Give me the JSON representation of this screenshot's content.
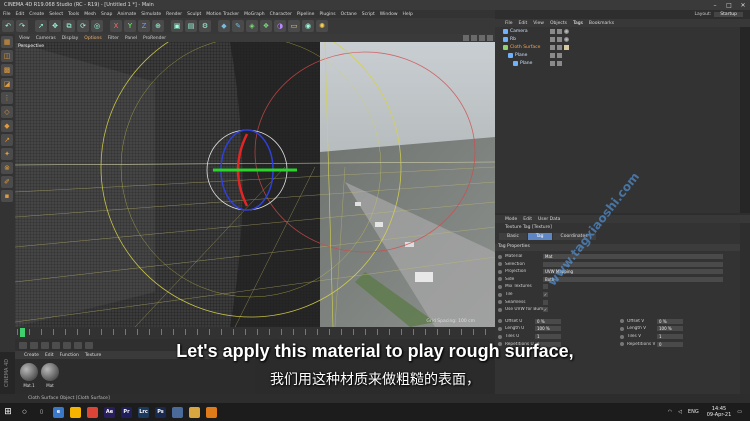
{
  "window": {
    "title": "CINEMA 4D R19.068 Studio (RC - R19) - [Untitled 1 *] - Main"
  },
  "menu": [
    "File",
    "Edit",
    "Create",
    "Select",
    "Tools",
    "Mesh",
    "Snap",
    "Animate",
    "Simulate",
    "Render",
    "Sculpt",
    "Motion Tracker",
    "MoGraph",
    "Character",
    "Pipeline",
    "Plugins",
    "Octane",
    "Script",
    "Window",
    "Help"
  ],
  "layout": {
    "label": "Layout:",
    "value": "Startup"
  },
  "viewport": {
    "menu": [
      "View",
      "Cameras",
      "Display",
      "Options",
      "Filter",
      "Panel",
      "ProRender"
    ],
    "active_menu": "Options",
    "camera_label": "Perspective",
    "grid_label": "Grid Spacing: 100 cm"
  },
  "object_manager": {
    "menu": [
      "File",
      "Edit",
      "View",
      "Objects",
      "Tags",
      "Bookmarks"
    ],
    "active_menu": "Tags",
    "objects": [
      {
        "name": "Camera",
        "indent": 0,
        "selected": false
      },
      {
        "name": "Rb",
        "indent": 0,
        "selected": false
      },
      {
        "name": "Cloth Surface",
        "indent": 0,
        "selected": true
      },
      {
        "name": "Plane",
        "indent": 1,
        "selected": false
      },
      {
        "name": "Plane",
        "indent": 2,
        "selected": false
      }
    ]
  },
  "attribute_manager": {
    "menu": [
      "Mode",
      "Edit",
      "User Data"
    ],
    "title": "Texture Tag [Texture]",
    "tabs": [
      "Basic",
      "Tag",
      "Coordinates"
    ],
    "active_tab": "Tag",
    "section": "Tag Properties",
    "props": [
      {
        "name": "Material",
        "value": "Mat",
        "type": "field"
      },
      {
        "name": "Selection",
        "value": "",
        "type": "field"
      },
      {
        "name": "Projection",
        "value": "UVW Mapping",
        "type": "field"
      },
      {
        "name": "Side",
        "value": "Both",
        "type": "field"
      },
      {
        "name": "Mix Textures",
        "value": "",
        "type": "check"
      },
      {
        "name": "Tile",
        "value": "✓",
        "type": "check"
      },
      {
        "name": "Seamless",
        "value": "",
        "type": "check"
      },
      {
        "name": "Use UVW for Bump",
        "value": "✓",
        "type": "check"
      }
    ],
    "pairs": [
      {
        "left": {
          "name": "Offset U",
          "value": "0 %"
        },
        "right": {
          "name": "Offset V",
          "value": "0 %"
        }
      },
      {
        "left": {
          "name": "Length U",
          "value": "100 %"
        },
        "right": {
          "name": "Length V",
          "value": "100 %"
        }
      },
      {
        "left": {
          "name": "Tiles U",
          "value": "1"
        },
        "right": {
          "name": "Tiles V",
          "value": "1"
        }
      },
      {
        "left": {
          "name": "Repetitions U",
          "value": "0"
        },
        "right": {
          "name": "Repetitions V",
          "value": "0"
        }
      }
    ]
  },
  "material_manager": {
    "menu": [
      "Create",
      "Edit",
      "Function",
      "Texture"
    ],
    "materials": [
      {
        "label": "Mat.1"
      },
      {
        "label": "Mat"
      }
    ],
    "side_label": "CINEMA 4D"
  },
  "status": {
    "text": "Cloth Surface Object [Cloth Surface]"
  },
  "watermark": "www.tagxiaoshi.com",
  "subtitles": {
    "en": "Let's apply this material to play rough surface,",
    "cn": "我们用这种材质来做粗糙的表面，"
  },
  "taskbar": {
    "apps": [
      {
        "label": "e",
        "color": "#3a78c9"
      },
      {
        "label": "",
        "color": "#f4b400"
      },
      {
        "label": "",
        "color": "#db4437"
      },
      {
        "label": "Ae",
        "color": "#2a1f5e"
      },
      {
        "label": "Pr",
        "color": "#1f1f5e"
      },
      {
        "label": "Lrc",
        "color": "#1c3a5e"
      },
      {
        "label": "Ps",
        "color": "#1a2a4e"
      },
      {
        "label": "",
        "color": "#4a6a9a"
      },
      {
        "label": "",
        "color": "#d9a640"
      },
      {
        "label": "",
        "color": "#e07b1a"
      }
    ],
    "lang": "ENG",
    "time": "14:45",
    "date": "09-Apr-21"
  },
  "colors": {
    "accent": "#5d86c2",
    "selected_object": "#f2a95c",
    "subtitle": "#ffffff"
  }
}
